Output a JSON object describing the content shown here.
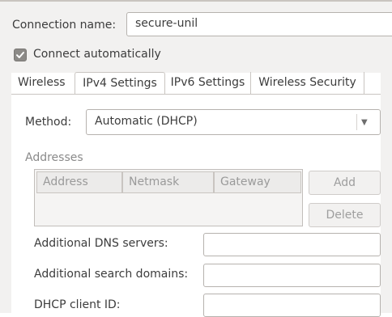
{
  "connection": {
    "name_label": "Connection name:",
    "name_value": "secure-unil",
    "auto_label": "Connect automatically",
    "auto_checked": true
  },
  "tabs": [
    {
      "label": "Wireless",
      "active": false
    },
    {
      "label": "IPv4 Settings",
      "active": true
    },
    {
      "label": "IPv6 Settings",
      "active": false
    },
    {
      "label": "Wireless Security",
      "active": false
    }
  ],
  "ipv4": {
    "method_label": "Method:",
    "method_value": "Automatic (DHCP)",
    "addresses_heading": "Addresses",
    "columns": [
      "Address",
      "Netmask",
      "Gateway"
    ],
    "add_label": "Add",
    "delete_label": "Delete",
    "dns_label": "Additional DNS servers:",
    "dns_value": "",
    "search_label": "Additional search domains:",
    "search_value": "",
    "dhcp_label": "DHCP client ID:",
    "dhcp_value": ""
  },
  "colors": {
    "window_bg": "#f2f1f0",
    "panel_bg": "#ffffff",
    "checkbox": "#8c8a87",
    "disabled_text": "#9e9e9e"
  }
}
